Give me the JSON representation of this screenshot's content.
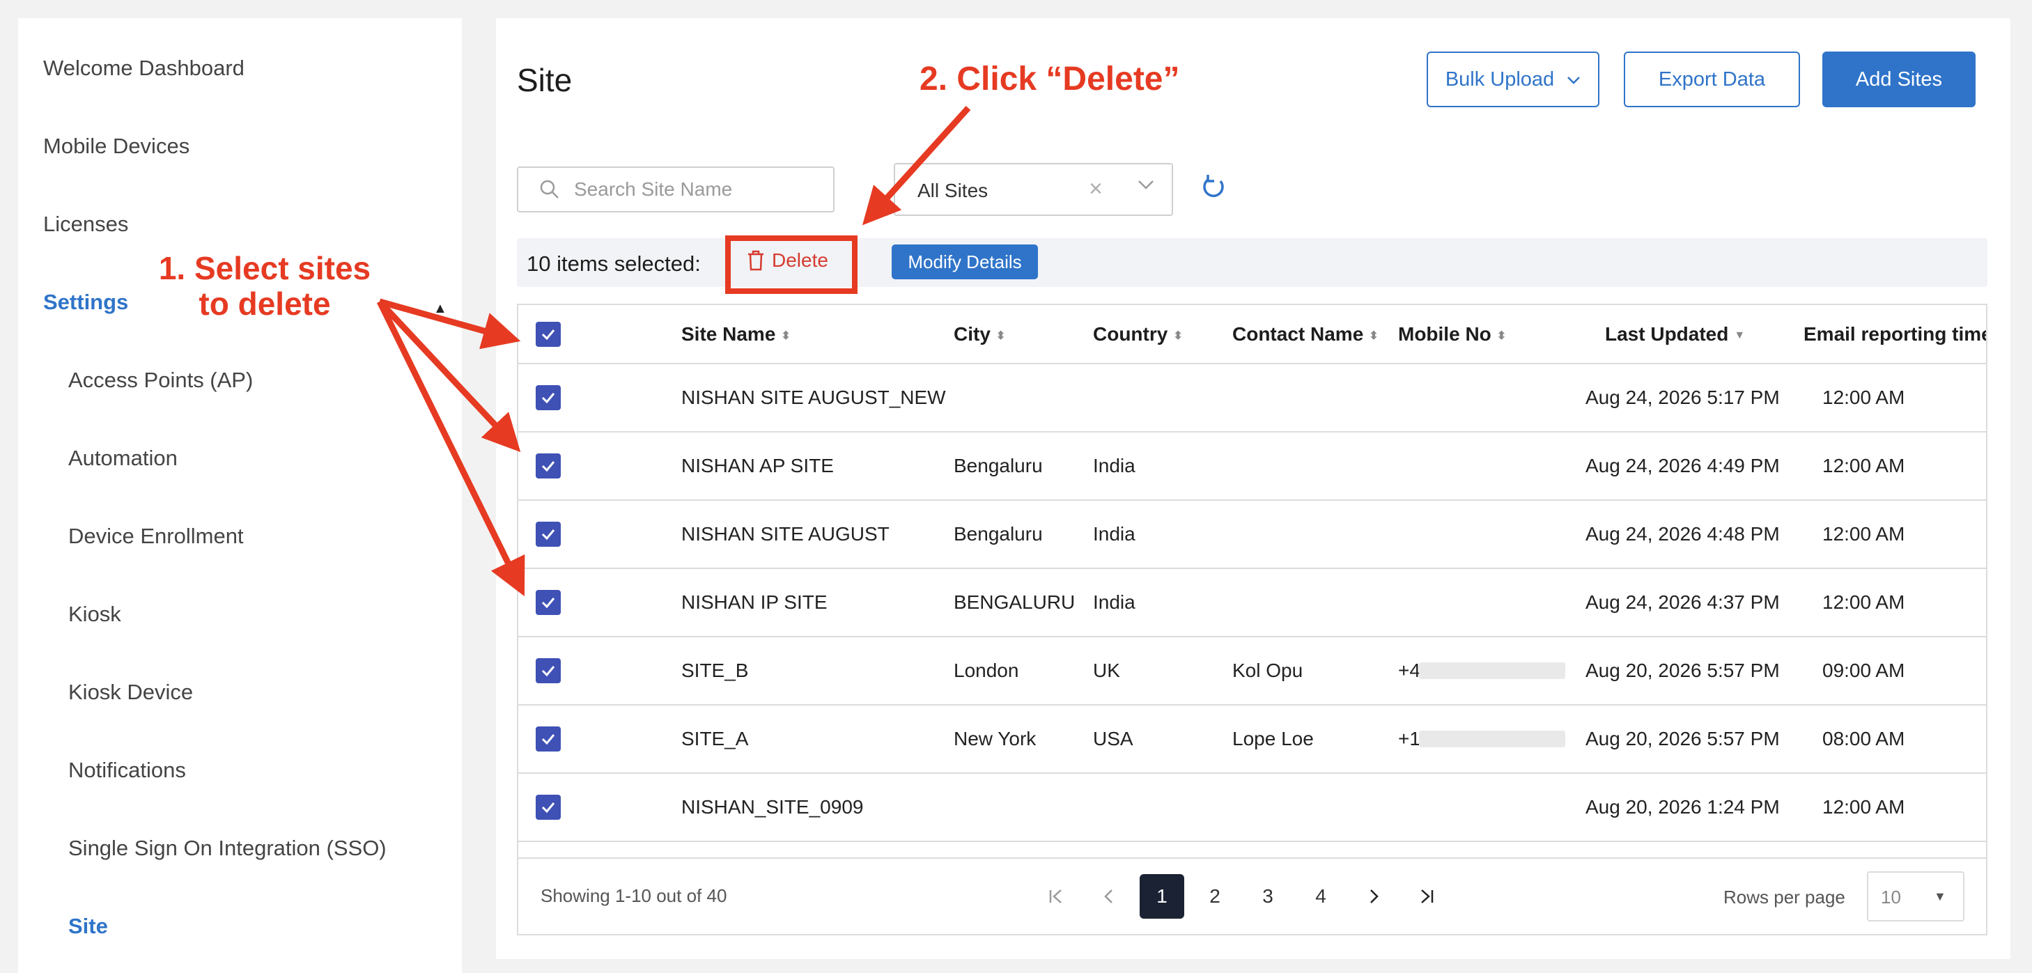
{
  "sidebar": {
    "items": [
      {
        "label": "Welcome Dashboard"
      },
      {
        "label": "Mobile Devices"
      },
      {
        "label": "Licenses"
      },
      {
        "label": "Settings"
      },
      {
        "label": "Access Points (AP)"
      },
      {
        "label": "Automation"
      },
      {
        "label": "Device Enrollment"
      },
      {
        "label": "Kiosk"
      },
      {
        "label": "Kiosk Device"
      },
      {
        "label": "Notifications"
      },
      {
        "label": "Single Sign On Integration (SSO)"
      },
      {
        "label": "Site"
      }
    ]
  },
  "header": {
    "title": "Site",
    "bulk_upload": "Bulk Upload",
    "export_data": "Export Data",
    "add_sites": "Add Sites"
  },
  "filters": {
    "search_placeholder": "Search Site Name",
    "site_filter_value": "All Sites"
  },
  "selection": {
    "count_text": "10 items selected:",
    "delete_label": "Delete",
    "modify_label": "Modify Details"
  },
  "table": {
    "columns": [
      "Site Name",
      "City",
      "Country",
      "Contact Name",
      "Mobile No",
      "Last Updated",
      "Email reporting time"
    ],
    "rows": [
      {
        "site": "NISHAN SITE AUGUST_NEW",
        "city": "",
        "country": "",
        "contact": "",
        "mobile": "",
        "updated": "Aug 24, 2026 5:17 PM",
        "email_time": "12:00 AM"
      },
      {
        "site": "NISHAN AP SITE",
        "city": "Bengaluru",
        "country": "India",
        "contact": "",
        "mobile": "",
        "updated": "Aug 24, 2026 4:49 PM",
        "email_time": "12:00 AM"
      },
      {
        "site": "NISHAN SITE AUGUST",
        "city": "Bengaluru",
        "country": "India",
        "contact": "",
        "mobile": "",
        "updated": "Aug 24, 2026 4:48 PM",
        "email_time": "12:00 AM"
      },
      {
        "site": "NISHAN IP SITE",
        "city": "BENGALURU",
        "country": "India",
        "contact": "",
        "mobile": "",
        "updated": "Aug 24, 2026 4:37 PM",
        "email_time": "12:00 AM"
      },
      {
        "site": "SITE_B",
        "city": "London",
        "country": "UK",
        "contact": "Kol Opu",
        "mobile": "+4",
        "updated": "Aug 20, 2026 5:57 PM",
        "email_time": "09:00 AM"
      },
      {
        "site": "SITE_A",
        "city": "New York",
        "country": "USA",
        "contact": "Lope Loe",
        "mobile": "+1",
        "updated": "Aug 20, 2026 5:57 PM",
        "email_time": "08:00 AM"
      },
      {
        "site": "NISHAN_SITE_0909",
        "city": "",
        "country": "",
        "contact": "",
        "mobile": "",
        "updated": "Aug 20, 2026 1:24 PM",
        "email_time": "12:00 AM"
      }
    ]
  },
  "pagination": {
    "showing": "Showing 1-10 out of 40",
    "pages": [
      "1",
      "2",
      "3",
      "4"
    ],
    "current_page": "1",
    "rows_per_page_label": "Rows per page",
    "rows_per_page_value": "10"
  },
  "annotations": {
    "step1": "1. Select sites to delete",
    "step2": "2. Click “Delete”",
    "color": "#e63a22"
  },
  "colors": {
    "accent": "#2f74c9",
    "checkbox": "#3f51b5",
    "delete": "#d63b2f",
    "active_page": "#1b2233"
  }
}
